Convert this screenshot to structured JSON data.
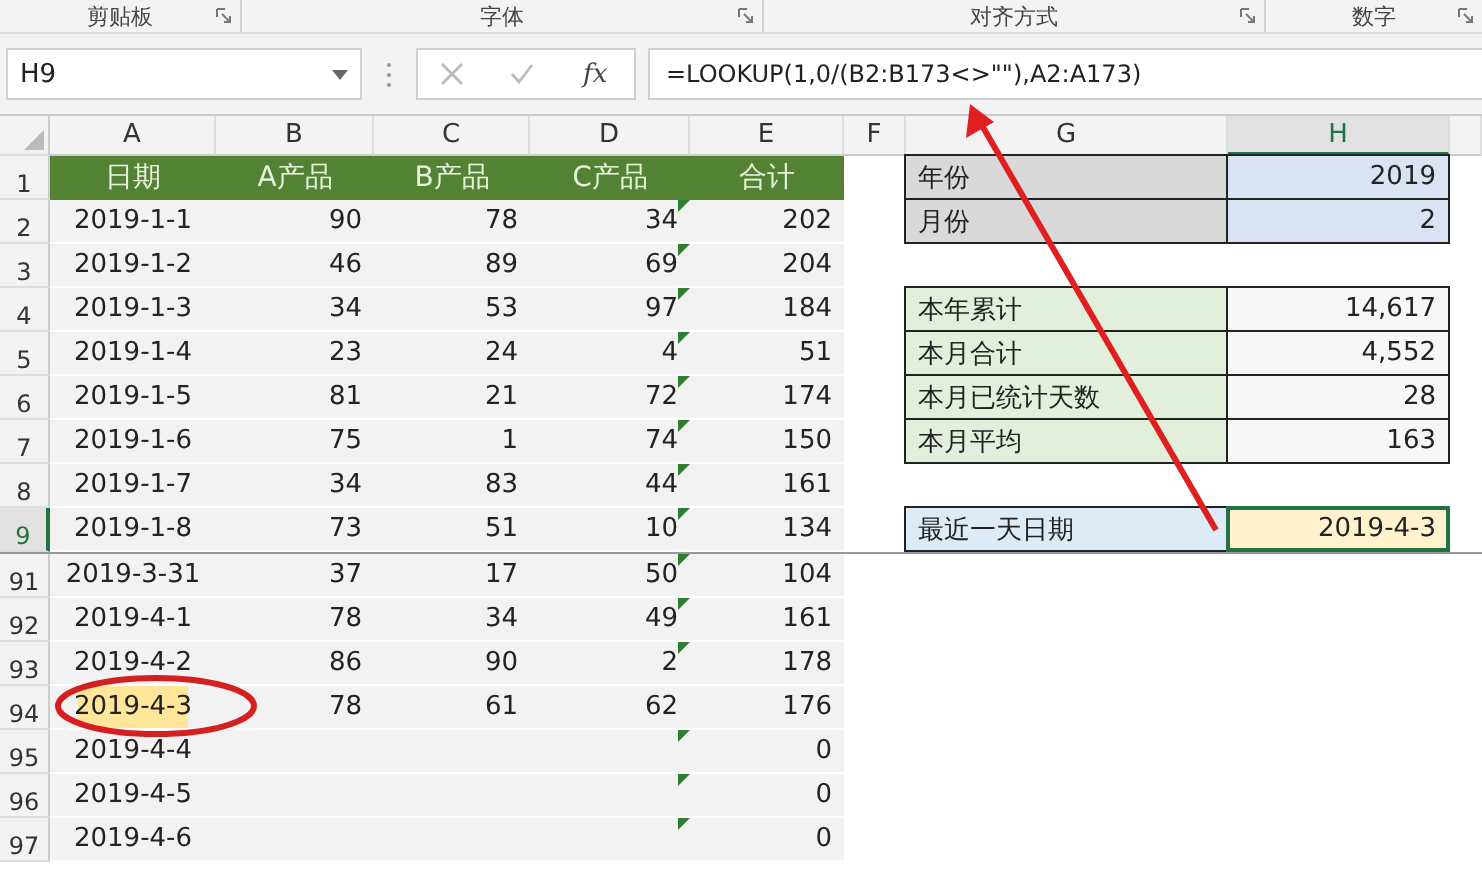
{
  "ribbon_groups": [
    "剪贴板",
    "字体",
    "对齐方式",
    "数字"
  ],
  "name_box": "H9",
  "function_button": "fx",
  "formula": "=LOOKUP(1,0/(B2:B173<>\"\"),A2:A173)",
  "columns": [
    {
      "label": "A",
      "selected": false
    },
    {
      "label": "B",
      "selected": false
    },
    {
      "label": "C",
      "selected": false
    },
    {
      "label": "D",
      "selected": false
    },
    {
      "label": "E",
      "selected": false
    },
    {
      "label": "F",
      "selected": false
    },
    {
      "label": "G",
      "selected": false
    },
    {
      "label": "H",
      "selected": true
    }
  ],
  "rows": [
    {
      "num": "1",
      "selected": false,
      "kind": "header",
      "cells": [
        "日期",
        "A产品",
        "B产品",
        "C产品",
        "合计"
      ],
      "side": {
        "kind": "input",
        "label": "年份",
        "value": "2019"
      }
    },
    {
      "num": "2",
      "selected": false,
      "kind": "data",
      "cells": [
        "2019-1-1",
        "90",
        "78",
        "34",
        "202"
      ],
      "flag": true,
      "highlight": false,
      "side": {
        "kind": "input",
        "label": "月份",
        "value": "2"
      }
    },
    {
      "num": "3",
      "selected": false,
      "kind": "data",
      "cells": [
        "2019-1-2",
        "46",
        "89",
        "69",
        "204"
      ],
      "flag": true,
      "highlight": false,
      "side": null
    },
    {
      "num": "4",
      "selected": false,
      "kind": "data",
      "cells": [
        "2019-1-3",
        "34",
        "53",
        "97",
        "184"
      ],
      "flag": true,
      "highlight": false,
      "side": {
        "kind": "summary",
        "label": "本年累计",
        "value": "14,617"
      }
    },
    {
      "num": "5",
      "selected": false,
      "kind": "data",
      "cells": [
        "2019-1-4",
        "23",
        "24",
        "4",
        "51"
      ],
      "flag": true,
      "highlight": false,
      "side": {
        "kind": "summary",
        "label": "本月合计",
        "value": "4,552"
      }
    },
    {
      "num": "6",
      "selected": false,
      "kind": "data",
      "cells": [
        "2019-1-5",
        "81",
        "21",
        "72",
        "174"
      ],
      "flag": true,
      "highlight": false,
      "side": {
        "kind": "summary",
        "label": "本月已统计天数",
        "value": "28"
      }
    },
    {
      "num": "7",
      "selected": false,
      "kind": "data",
      "cells": [
        "2019-1-6",
        "75",
        "1",
        "74",
        "150"
      ],
      "flag": true,
      "highlight": false,
      "side": {
        "kind": "summary",
        "label": "本月平均",
        "value": "163"
      }
    },
    {
      "num": "8",
      "selected": false,
      "kind": "data",
      "cells": [
        "2019-1-7",
        "34",
        "83",
        "44",
        "161"
      ],
      "flag": true,
      "highlight": false,
      "side": null
    },
    {
      "num": "9",
      "selected": true,
      "kind": "data",
      "cells": [
        "2019-1-8",
        "73",
        "51",
        "10",
        "134"
      ],
      "flag": true,
      "highlight": false,
      "side": {
        "kind": "result",
        "label": "最近一天日期",
        "value": "2019-4-3"
      }
    },
    {
      "num": "91",
      "selected": false,
      "kind": "data",
      "cells": [
        "2019-3-31",
        "37",
        "17",
        "50",
        "104"
      ],
      "flag": true,
      "highlight": false,
      "side": null
    },
    {
      "num": "92",
      "selected": false,
      "kind": "data",
      "cells": [
        "2019-4-1",
        "78",
        "34",
        "49",
        "161"
      ],
      "flag": true,
      "highlight": false,
      "side": null
    },
    {
      "num": "93",
      "selected": false,
      "kind": "data",
      "cells": [
        "2019-4-2",
        "86",
        "90",
        "2",
        "178"
      ],
      "flag": true,
      "highlight": false,
      "side": null
    },
    {
      "num": "94",
      "selected": false,
      "kind": "data",
      "cells": [
        "2019-4-3",
        "78",
        "61",
        "62",
        "176"
      ],
      "flag": false,
      "highlight": true,
      "side": null
    },
    {
      "num": "95",
      "selected": false,
      "kind": "data",
      "cells": [
        "2019-4-4",
        "",
        "",
        "",
        "0"
      ],
      "flag": true,
      "highlight": false,
      "side": null
    },
    {
      "num": "96",
      "selected": false,
      "kind": "data",
      "cells": [
        "2019-4-5",
        "",
        "",
        "",
        "0"
      ],
      "flag": true,
      "highlight": false,
      "side": null
    },
    {
      "num": "97",
      "selected": false,
      "kind": "data",
      "cells": [
        "2019-4-6",
        "",
        "",
        "",
        "0"
      ],
      "flag": true,
      "highlight": false,
      "side": null
    }
  ]
}
